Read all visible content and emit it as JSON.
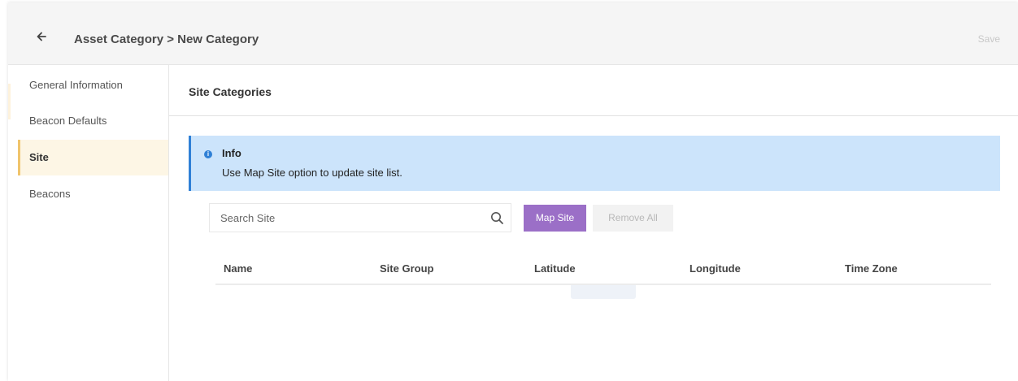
{
  "header": {
    "title": "Asset Category > New Category",
    "save_label": "Save",
    "back_icon": "arrow-left-icon"
  },
  "sidebar": {
    "items": [
      {
        "label": "General Information",
        "active": false
      },
      {
        "label": "Beacon Defaults",
        "active": false
      },
      {
        "label": "Site",
        "active": true
      },
      {
        "label": "Beacons",
        "active": false
      }
    ]
  },
  "main": {
    "section_title": "Site Categories",
    "info": {
      "icon": "info-icon",
      "icon_glyph": "i",
      "title": "Info",
      "text": "Use Map Site option to update site list."
    },
    "search": {
      "placeholder": "Search Site",
      "value": "",
      "icon": "search-icon"
    },
    "buttons": {
      "map_site": "Map Site",
      "remove_all": "Remove All"
    },
    "table": {
      "columns": [
        "Name",
        "Site Group",
        "Latitude",
        "Longitude",
        "Time Zone"
      ],
      "rows": []
    }
  },
  "colors": {
    "accent_purple": "#9b6fc7",
    "info_background": "#cce4fb",
    "info_border": "#2f80d6",
    "active_item_background": "#fdf6e5",
    "active_item_border": "#f0c46b"
  }
}
